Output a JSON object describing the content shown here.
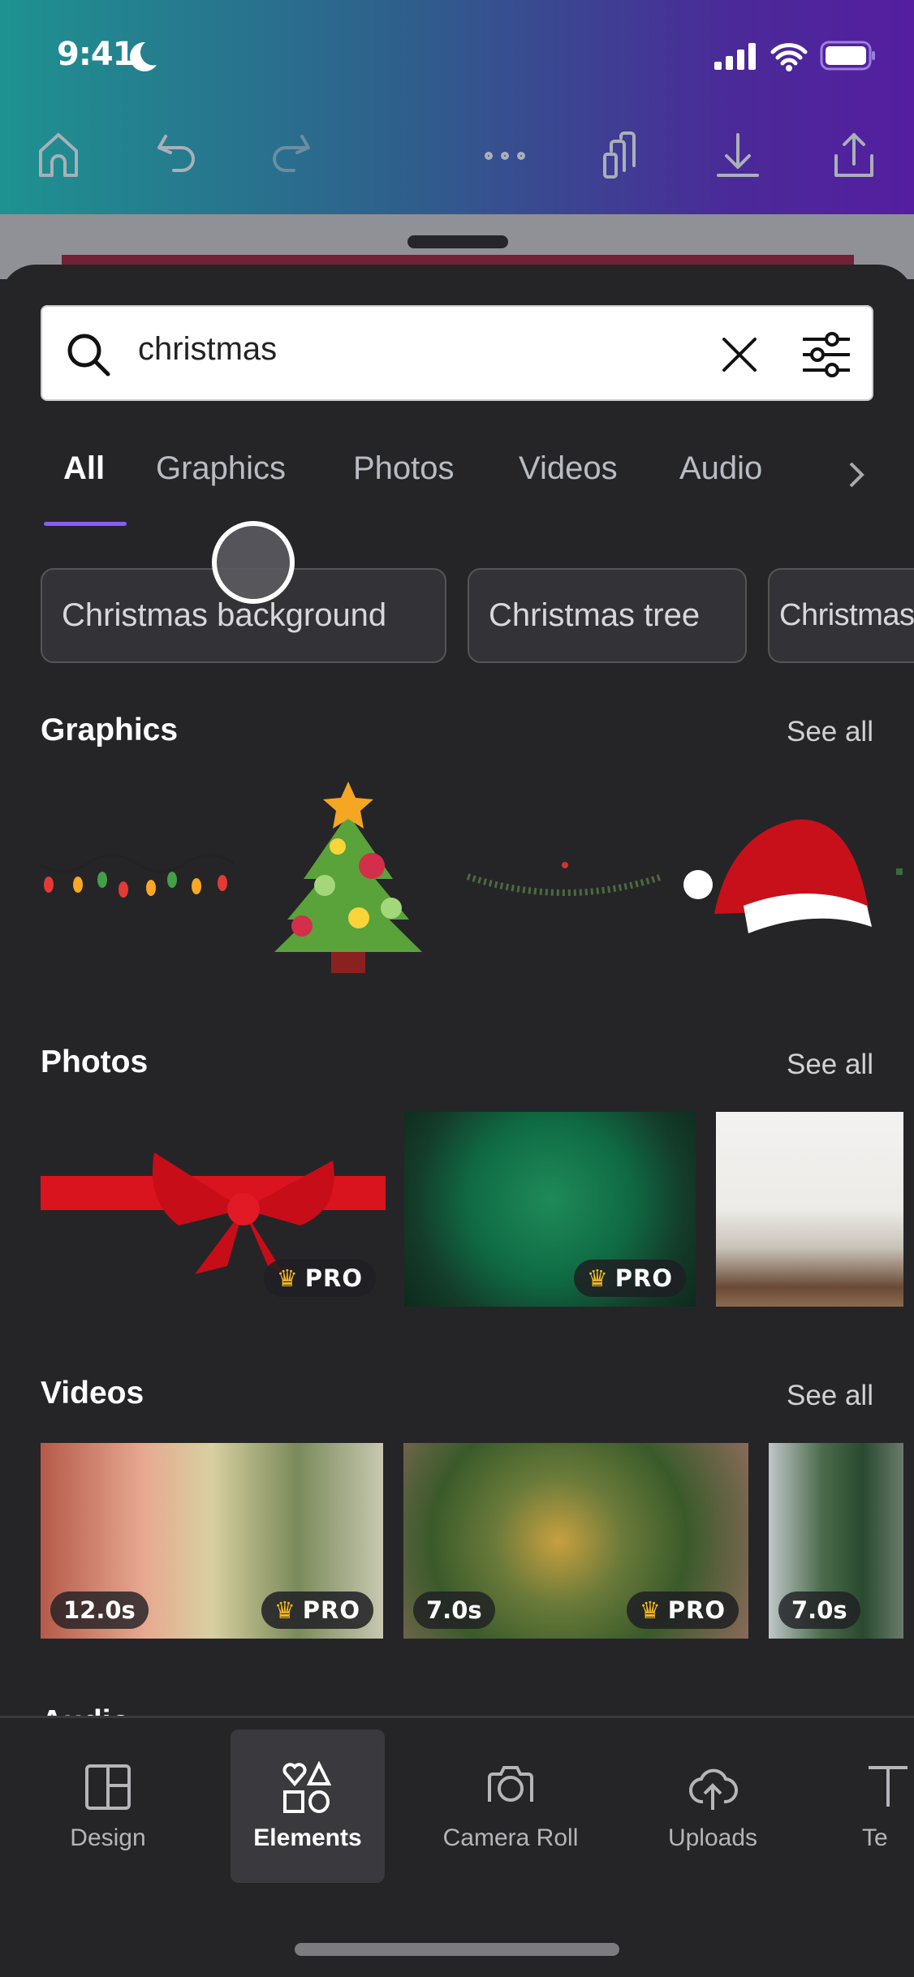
{
  "status_bar": {
    "time": "9:41",
    "icons": [
      "moon-icon",
      "signal-icon",
      "wifi-icon",
      "battery-icon"
    ]
  },
  "toolbar": {
    "icons": [
      "home-icon",
      "undo-icon",
      "redo-icon",
      "more-icon",
      "pages-icon",
      "download-icon",
      "share-icon"
    ]
  },
  "search": {
    "value": "christmas",
    "icons": [
      "search-icon",
      "clear-icon",
      "filter-icon"
    ]
  },
  "tabs": [
    {
      "label": "All",
      "active": true
    },
    {
      "label": "Graphics"
    },
    {
      "label": "Photos"
    },
    {
      "label": "Videos"
    },
    {
      "label": "Audio"
    }
  ],
  "chips": [
    "Christmas background",
    "Christmas tree",
    "Christmas"
  ],
  "sections": {
    "graphics": {
      "title": "Graphics",
      "see_all": "See all",
      "items": [
        "christmas-lights",
        "christmas-tree",
        "garland",
        "santa-hat"
      ]
    },
    "photos": {
      "title": "Photos",
      "see_all": "See all",
      "items": [
        {
          "badge": "PRO"
        },
        {
          "badge": "PRO"
        },
        {}
      ]
    },
    "videos": {
      "title": "Videos",
      "see_all": "See all",
      "items": [
        {
          "duration": "12.0s",
          "badge": "PRO"
        },
        {
          "duration": "7.0s",
          "badge": "PRO"
        },
        {
          "duration": "7.0s"
        }
      ]
    },
    "audio": {
      "title": "Audio"
    }
  },
  "bottom_nav": [
    {
      "label": "Design",
      "icon": "layout-icon"
    },
    {
      "label": "Elements",
      "icon": "shapes-icon",
      "active": true
    },
    {
      "label": "Camera Roll",
      "icon": "camera-icon"
    },
    {
      "label": "Uploads",
      "icon": "upload-cloud-icon"
    },
    {
      "label": "Te",
      "icon": "text-icon"
    }
  ],
  "colors": {
    "accent": "#8b5cf6",
    "panel": "#252528",
    "pro_crown": "#f5b820"
  }
}
